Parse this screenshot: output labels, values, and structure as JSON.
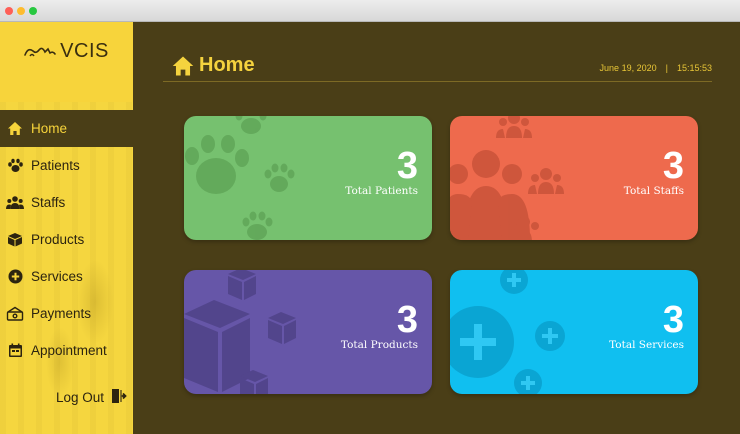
{
  "window": {
    "controls": [
      "close",
      "minimize",
      "maximize"
    ]
  },
  "brand": {
    "logo_text": "VCIS",
    "logo_icon": "cat-dog-outline-icon"
  },
  "sidebar": {
    "items": [
      {
        "label": "Home",
        "icon": "home-icon",
        "active": true
      },
      {
        "label": "Patients",
        "icon": "paw-icon"
      },
      {
        "label": "Staffs",
        "icon": "users-icon"
      },
      {
        "label": "Products",
        "icon": "box-icon"
      },
      {
        "label": "Services",
        "icon": "plus-circle-icon"
      },
      {
        "label": "Payments",
        "icon": "payment-icon"
      },
      {
        "label": "Appointment",
        "icon": "calendar-icon"
      }
    ],
    "logout_label": "Log Out",
    "logout_icon": "logout-icon"
  },
  "header": {
    "title": "Home",
    "title_icon": "home-icon",
    "date": "June 19, 2020",
    "separator": "|",
    "time": "15:15:53"
  },
  "cards": {
    "patients": {
      "count": "3",
      "label": "Total Patients",
      "color": "#76c16f",
      "icon": "paw-icon"
    },
    "staffs": {
      "count": "3",
      "label": "Total Staffs",
      "color": "#ee6a4d",
      "icon": "users-icon"
    },
    "products": {
      "count": "3",
      "label": "Total Products",
      "color": "#6656a8",
      "icon": "box-icon"
    },
    "services": {
      "count": "3",
      "label": "Total Services",
      "color": "#10bff0",
      "icon": "plus-circle-icon"
    }
  },
  "colors": {
    "background": "#4a3e17",
    "sidebar": "#f7d43b",
    "accent": "#f5d33e"
  }
}
